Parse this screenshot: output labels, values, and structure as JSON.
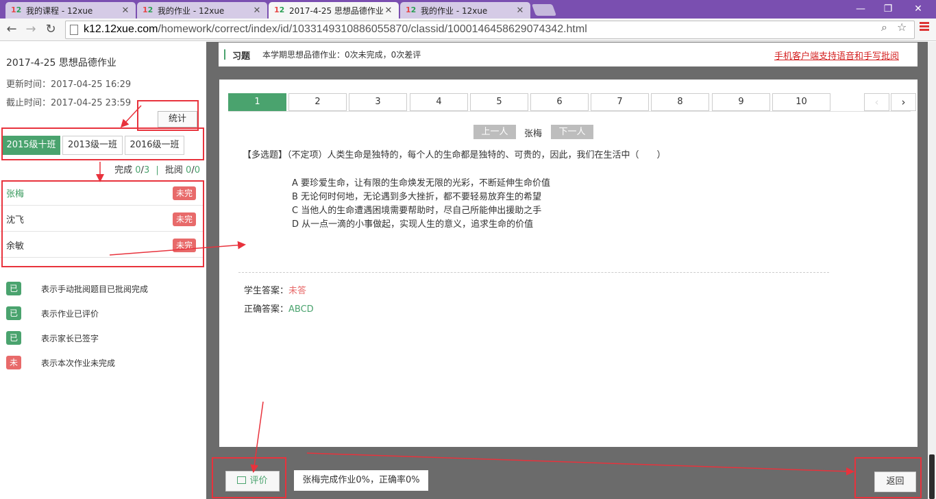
{
  "browser": {
    "tabs": [
      {
        "title": "我的课程 - 12xue",
        "active": false
      },
      {
        "title": "我的作业 - 12xue",
        "active": false
      },
      {
        "title": "2017-4-25 思想品德作业",
        "active": true
      },
      {
        "title": "我的作业 - 12xue",
        "active": false
      }
    ],
    "favicon_text": "12",
    "url_host": "k12.12xue.com",
    "url_path": "/homework/correct/index/id/1033149310886055870/classid/1000146458629074342.html"
  },
  "left": {
    "title": "2017-4-25 思想品德作业",
    "update_time": "更新时间：2017-04-25 16:29",
    "deadline": "截止时间：2017-04-25 23:59",
    "stats_button": "统计",
    "class_tabs": [
      "2015级十班",
      "2013级一班",
      "2016级一班"
    ],
    "progress": {
      "complete_label": "完成",
      "complete_done": "0",
      "complete_total": "3",
      "review_label": "批阅",
      "review_done": "0",
      "review_total": "0"
    },
    "students": [
      {
        "name": "张梅",
        "status": "未完"
      },
      {
        "name": "沈飞",
        "status": "未完"
      },
      {
        "name": "余敏",
        "status": "未完"
      }
    ],
    "legend": [
      {
        "badge": "已批",
        "text": "表示手动批阅题目已批阅完成",
        "color": "#4aa36e"
      },
      {
        "badge": "已评",
        "text": "表示作业已评价",
        "color": "#4aa36e"
      },
      {
        "badge": "已签",
        "text": "表示家长已签字",
        "color": "#4aa36e"
      },
      {
        "badge": "未完",
        "text": "表示本次作业未完成",
        "color": "#e86a6a"
      }
    ]
  },
  "info": {
    "section": "习题",
    "stats": "本学期思想品德作业：0次未完成，0次差评",
    "mobile_link": "手机客户端支持语音和手写批阅"
  },
  "question": {
    "tabs": [
      "1",
      "2",
      "3",
      "4",
      "5",
      "6",
      "7",
      "8",
      "9",
      "10"
    ],
    "prev_student": "上一人",
    "current_student": "张梅",
    "next_student": "下一人",
    "stem": "【多选题】（不定项）人类生命是独特的，每个人的生命都是独特的、可贵的，因此，我们在生活中（　　）",
    "options": [
      "A 要珍爱生命，让有限的生命焕发无限的光彩，不断延伸生命价值",
      "B 无论何时何地，无论遇到多大挫折，都不要轻易放弃生的希望",
      "C 当他人的生命遭遇困境需要帮助时，尽自己所能伸出援助之手",
      "D 从一点一滴的小事做起，实现人生的意义，追求生命的价值"
    ],
    "student_answer_label": "学生答案：",
    "student_answer": "未答",
    "correct_answer_label": "正确答案：",
    "correct_answer": "ABCD"
  },
  "footer": {
    "eval_button": "评价",
    "summary": "张梅完成作业0%，正确率0%",
    "back_button": "返回"
  },
  "colors": {
    "accent": "#4aa36e",
    "danger": "#e86a6a",
    "tabbar": "#7a4fb0",
    "annotation": "#e8323c"
  }
}
